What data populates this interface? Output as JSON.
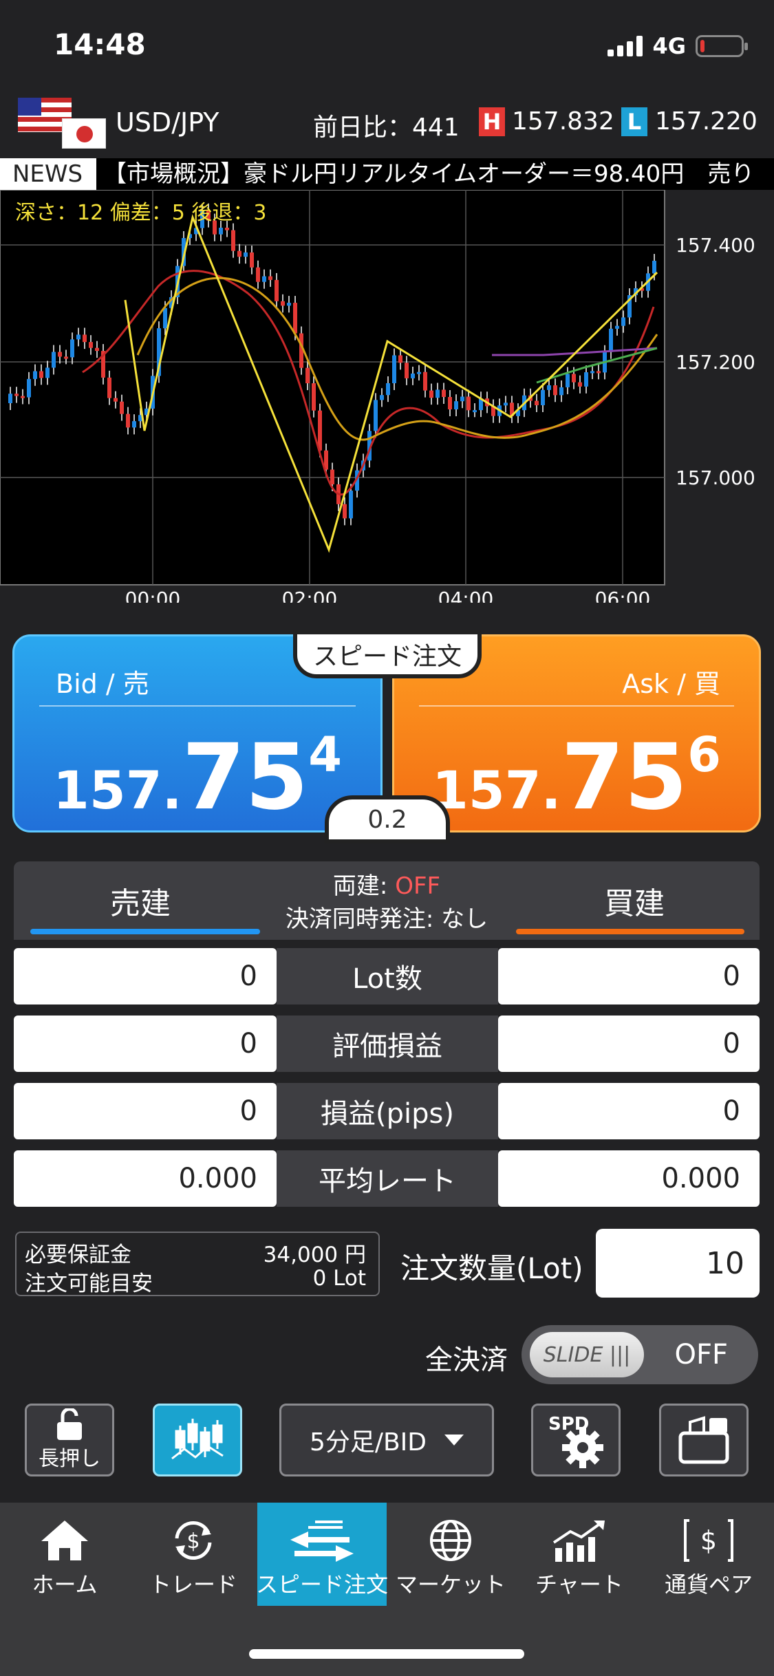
{
  "status": {
    "time": "14:48",
    "network": "4G"
  },
  "header": {
    "pair": "USD/JPY",
    "prev_change": "前日比：441",
    "high_badge": "H",
    "high": "157.832",
    "low_badge": "L",
    "low": "157.220"
  },
  "news": {
    "tag": "NEWS",
    "text": "【市場概況】豪ドル円リアルタイムオーダー＝98.40円　売り"
  },
  "chart": {
    "info": "深さ：12 偏差：5 後退：3",
    "y_labels": [
      "157.400",
      "157.200",
      "157.000"
    ],
    "x_labels": [
      "00:00",
      "02:00",
      "04:00",
      "06:00"
    ]
  },
  "quote": {
    "bid_label": "Bid / 売",
    "bid_small": "157.",
    "bid_big": "75",
    "bid_sup": "4",
    "ask_label": "Ask / 買",
    "ask_small": "157.",
    "ask_big": "75",
    "ask_sup": "6",
    "speed_tab": "スピード注文",
    "spread": "0.2"
  },
  "positions": {
    "sell_tab": "売建",
    "buy_tab": "買建",
    "hedge_label": "両建: ",
    "hedge_value": "OFF",
    "settle_label": "決済同時発注: なし",
    "rows": [
      {
        "label": "Lot数",
        "sell": "0",
        "buy": "0"
      },
      {
        "label": "評価損益",
        "sell": "0",
        "buy": "0"
      },
      {
        "label": "損益(pips)",
        "sell": "0",
        "buy": "0"
      },
      {
        "label": "平均レート",
        "sell": "0.000",
        "buy": "0.000"
      }
    ]
  },
  "margin": {
    "required_label": "必要保証金",
    "required_value": "34,000  円",
    "available_label": "注文可能目安",
    "available_value": "0 Lot"
  },
  "order": {
    "lot_label": "注文数量(Lot)",
    "lot_value": "10"
  },
  "close_all": {
    "label": "全決済",
    "slide_text": "SLIDE |||",
    "state": "OFF"
  },
  "toolbar": {
    "lock_label": "長押し",
    "period": "5分足/BID",
    "spd": "SPD"
  },
  "tabs": [
    {
      "label": "ホーム",
      "icon": "home-icon"
    },
    {
      "label": "トレード",
      "icon": "dollar-cycle-icon"
    },
    {
      "label": "スピード注文",
      "icon": "arrows-icon"
    },
    {
      "label": "マーケット",
      "icon": "globe-icon"
    },
    {
      "label": "チャート",
      "icon": "chart-icon"
    },
    {
      "label": "通貨ペア",
      "icon": "currency-pair-icon"
    }
  ],
  "colors": {
    "bid": "#2170d9",
    "ask": "#f26b12",
    "accent": "#1aa3cf"
  }
}
